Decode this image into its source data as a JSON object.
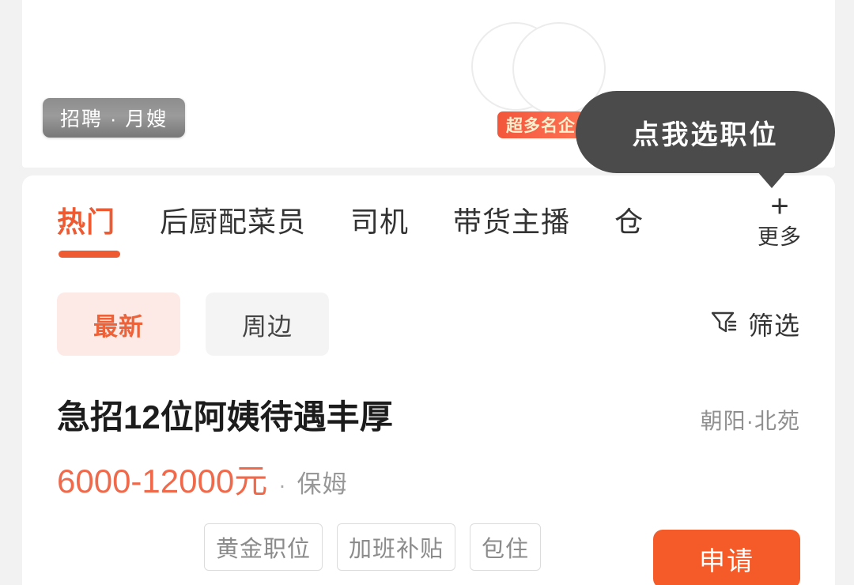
{
  "banner": {
    "recruit_pill_label": "招聘 · 月嫂",
    "hot_badge_label": "超多名企",
    "tooltip_label": "点我选职位",
    "tooltip_color": "#4b4b4b",
    "badge_color": "#f2553a",
    "pill_color": "#8d8d8d"
  },
  "tabs": {
    "items": [
      {
        "label": "热门",
        "active": true
      },
      {
        "label": "后厨配菜员",
        "active": false
      },
      {
        "label": "司机",
        "active": false
      },
      {
        "label": "带货主播",
        "active": false
      },
      {
        "label": "仓",
        "active": false
      }
    ],
    "more_plus": "+",
    "more_label": "更多",
    "accent_color": "#ee5a32"
  },
  "chips": {
    "items": [
      {
        "label": "最新",
        "active": true
      },
      {
        "label": "周边",
        "active": false
      }
    ],
    "filter_label": "筛选",
    "active_bg": "#fdeae6",
    "active_text": "#ed6239"
  },
  "job": {
    "title": "急招12位阿姨待遇丰厚",
    "location": "朝阳·北苑",
    "salary": "6000-12000元",
    "salary_separator": "·",
    "role": "保姆",
    "salary_color": "#f0694a",
    "tags": [
      "黄金职位",
      "加班补贴",
      "包住"
    ],
    "apply_label": "申请",
    "apply_color": "#f55b29"
  }
}
